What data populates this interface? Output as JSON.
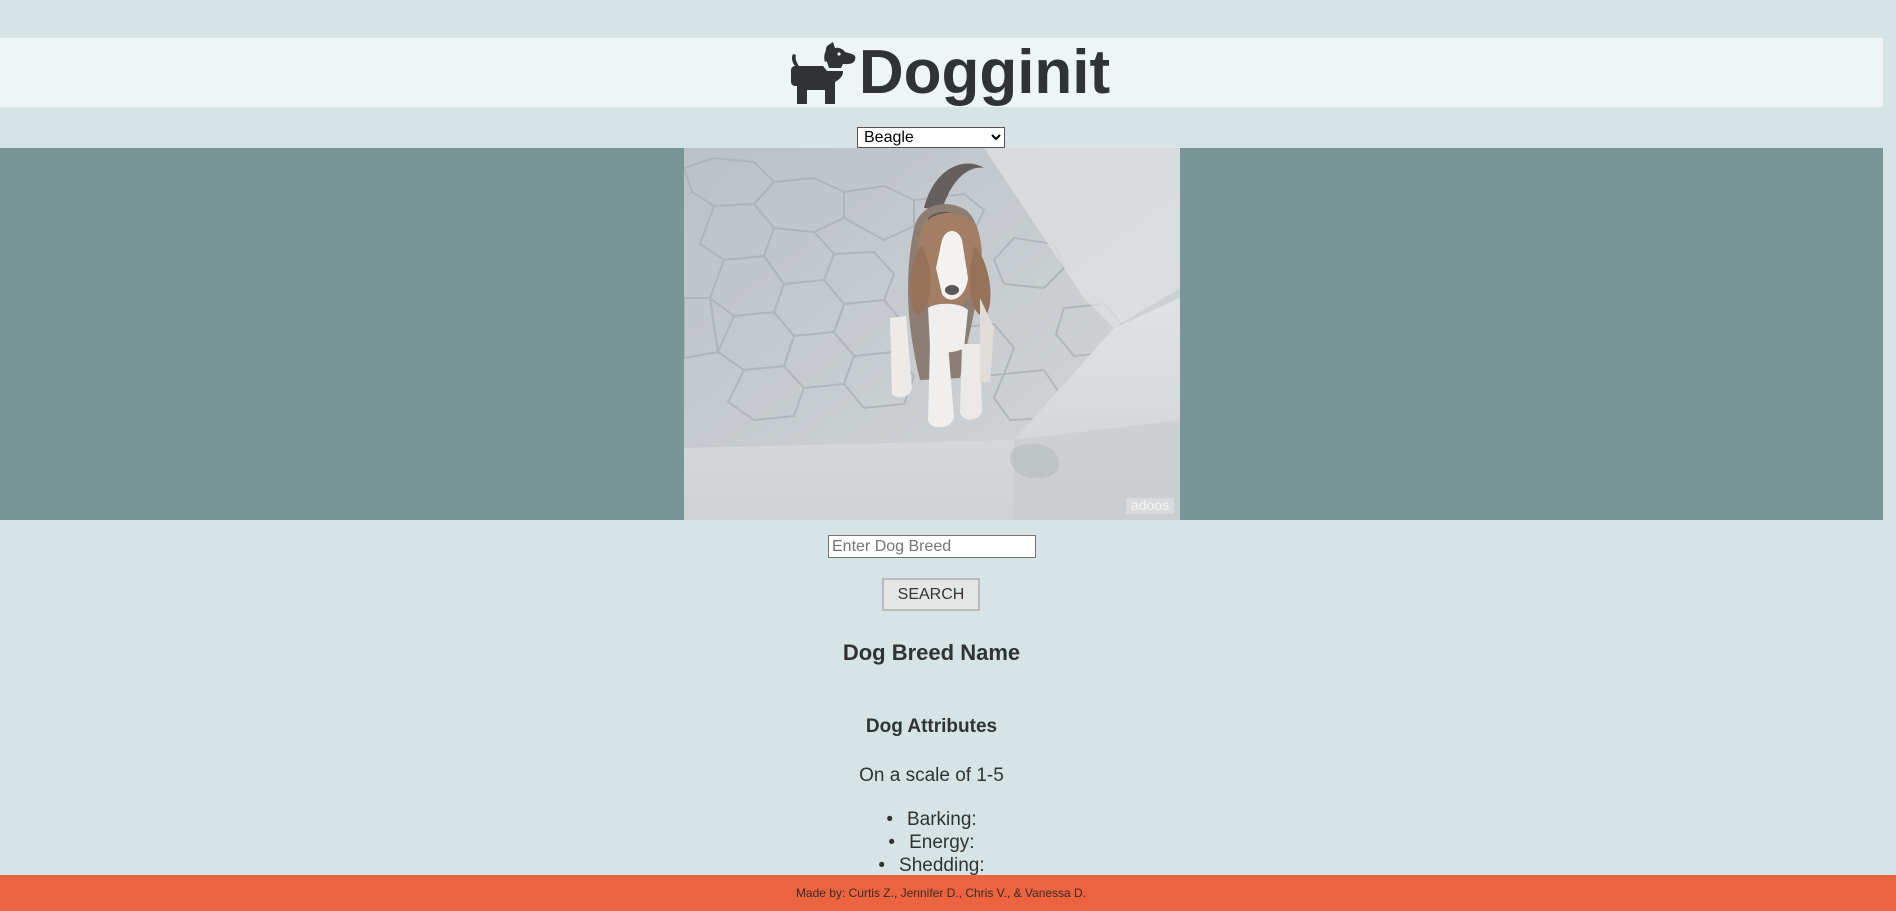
{
  "header": {
    "title": "Dogginit",
    "logo_icon": "dog-icon"
  },
  "breed_select": {
    "selected": "Beagle",
    "options": [
      "Beagle"
    ]
  },
  "gallery": {
    "image_subject": "beagle puppy on paved stones",
    "watermark": "adoos"
  },
  "search": {
    "placeholder": "Enter Dog Breed",
    "value": "",
    "button_label": "SEARCH"
  },
  "breed_info": {
    "name_heading": "Dog Breed Name",
    "attributes_heading": "Dog Attributes",
    "scale_note": "On a scale of 1-5",
    "attributes": [
      {
        "label": "Barking:"
      },
      {
        "label": "Energy:"
      },
      {
        "label": "Shedding:"
      }
    ]
  },
  "footer": {
    "credits": "Made by: Curtis Z., Jennifer D., Chris V., & Vanessa D."
  },
  "colors": {
    "page_bg": "#d6e4e5",
    "header_bg": "#eef5f5",
    "gallery_bg": "#789696",
    "footer_bg": "#ec643f",
    "text": "#2f3334"
  }
}
